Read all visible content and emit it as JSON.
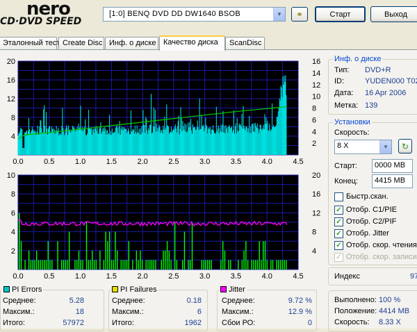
{
  "header": {
    "logo_top": "nero",
    "logo_bottom": "CD·DVD SPEED",
    "drive": "[1:0]  BENQ DVD DD DW1640 BSOB",
    "start_label": "Старт",
    "exit_label": "Выход"
  },
  "tabs": [
    "Эталонный тест",
    "Create Disc",
    "Инф. о диске",
    "Качество диска",
    "ScanDisc"
  ],
  "chart1": {
    "y_left": [
      "20",
      "16",
      "12",
      "8",
      "4"
    ],
    "y_right": [
      "16",
      "14",
      "12",
      "10",
      "8",
      "6",
      "4",
      "2"
    ],
    "x": [
      "0.0",
      "0.5",
      "1.0",
      "1.5",
      "2.0",
      "2.5",
      "3.0",
      "3.5",
      "4.0",
      "4.5"
    ]
  },
  "chart2": {
    "y_left": [
      "10",
      "8",
      "6",
      "4",
      "2"
    ],
    "y_right": [
      "20",
      "16",
      "12",
      "8",
      "4"
    ],
    "x": [
      "0.0",
      "0.5",
      "1.0",
      "1.5",
      "2.0",
      "2.5",
      "3.0",
      "3.5",
      "4.0",
      "4.5"
    ]
  },
  "chart_data": [
    {
      "type": "area",
      "x_range": [
        0,
        4.5
      ],
      "y_left_range": [
        0,
        20
      ],
      "y_right_range": [
        0,
        16
      ],
      "series": [
        {
          "name": "PI Errors",
          "color": "#00e0e0"
        },
        {
          "name": "Read speed",
          "color": "#00c000"
        }
      ],
      "speed_curve_x": [
        0.0,
        0.1,
        0.5,
        1.0,
        1.5,
        2.0,
        2.5,
        3.0,
        3.5,
        4.0,
        4.3
      ],
      "speed_curve_y": [
        2.7,
        3.4,
        3.8,
        4.4,
        5.0,
        5.6,
        6.2,
        6.8,
        7.4,
        7.9,
        8.2
      ],
      "pi_avg": 5.28,
      "pi_max": 18
    },
    {
      "type": "bar",
      "x_range": [
        0,
        4.5
      ],
      "y_left_range": [
        0,
        10
      ],
      "y_right_range": [
        0,
        20
      ],
      "series": [
        {
          "name": "PI Failures",
          "color": "#00ff00"
        },
        {
          "name": "Jitter",
          "color": "#ff00ff"
        }
      ],
      "jitter_percent_avg": 9.72,
      "pif_max": 6
    }
  ],
  "disc_info": {
    "title": "Инф. о диске",
    "rows": [
      {
        "k": "Тип:",
        "v": "DVD+R"
      },
      {
        "k": "ID:",
        "v": "YUDEN000 T02"
      },
      {
        "k": "Дата:",
        "v": "16 Apr 2006"
      },
      {
        "k": "Метка:",
        "v": "139"
      }
    ]
  },
  "settings": {
    "title": "Установки",
    "speed_label": "Скорость:",
    "speed_value": "8 X",
    "start_label": "Старт:",
    "start_value": "0000 MB",
    "end_label": "Конец:",
    "end_value": "4415 MB",
    "checks": [
      {
        "label": "Быстр.скан.",
        "checked": false,
        "disabled": false
      },
      {
        "label": "Отобр. C1/PIE",
        "checked": true,
        "disabled": false
      },
      {
        "label": "Отобр. C2/PIF",
        "checked": true,
        "disabled": false
      },
      {
        "label": "Отобр. Jitter",
        "checked": true,
        "disabled": false
      },
      {
        "label": "Отобр. скор. чтения",
        "checked": true,
        "disabled": false
      },
      {
        "label": "Отобр. скор. записи",
        "checked": true,
        "disabled": true
      }
    ]
  },
  "index": {
    "label": "Индекс",
    "value": "97"
  },
  "progress": {
    "rows": [
      {
        "k": "Выполнено:",
        "v": "100 %"
      },
      {
        "k": "Положение:",
        "v": "4414 MB"
      },
      {
        "k": "Скорость:",
        "v": "8.33 X"
      }
    ]
  },
  "stats": {
    "pie": {
      "title": "PI Errors",
      "color": "#00c8c8",
      "rows": [
        {
          "k": "Среднее:",
          "v": "5.28"
        },
        {
          "k": "Максим.:",
          "v": "18"
        },
        {
          "k": "Итого:",
          "v": "57972"
        }
      ]
    },
    "pif": {
      "title": "PI Failures",
      "color": "#e0e000",
      "rows": [
        {
          "k": "Среднее:",
          "v": "0.18"
        },
        {
          "k": "Максим.:",
          "v": "6"
        },
        {
          "k": "Итого:",
          "v": "1962"
        }
      ]
    },
    "jitter": {
      "title": "Jitter",
      "color": "#ff00ff",
      "rows": [
        {
          "k": "Среднее:",
          "v": "9.72 %"
        },
        {
          "k": "Максим.:",
          "v": "12.9 %"
        },
        {
          "k": "Сбои РО:",
          "v": "0"
        }
      ]
    }
  }
}
